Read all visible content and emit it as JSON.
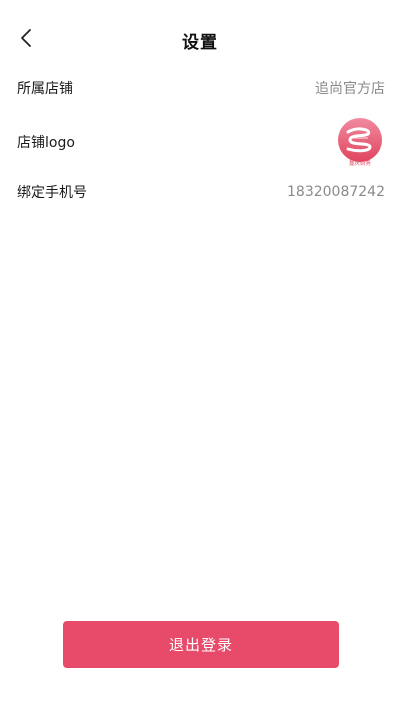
{
  "header": {
    "title": "设置",
    "back_icon": "chevron-left-icon"
  },
  "settings": {
    "store": {
      "label": "所属店铺",
      "value": "追尚官方店"
    },
    "logo": {
      "label": "店铺logo",
      "logo_text": "蔓庆财务",
      "logo_color": "#e84a69"
    },
    "phone": {
      "label": "绑定手机号",
      "value": "18320087242"
    }
  },
  "footer": {
    "logout_label": "退出登录",
    "logout_color": "#e84a69"
  }
}
